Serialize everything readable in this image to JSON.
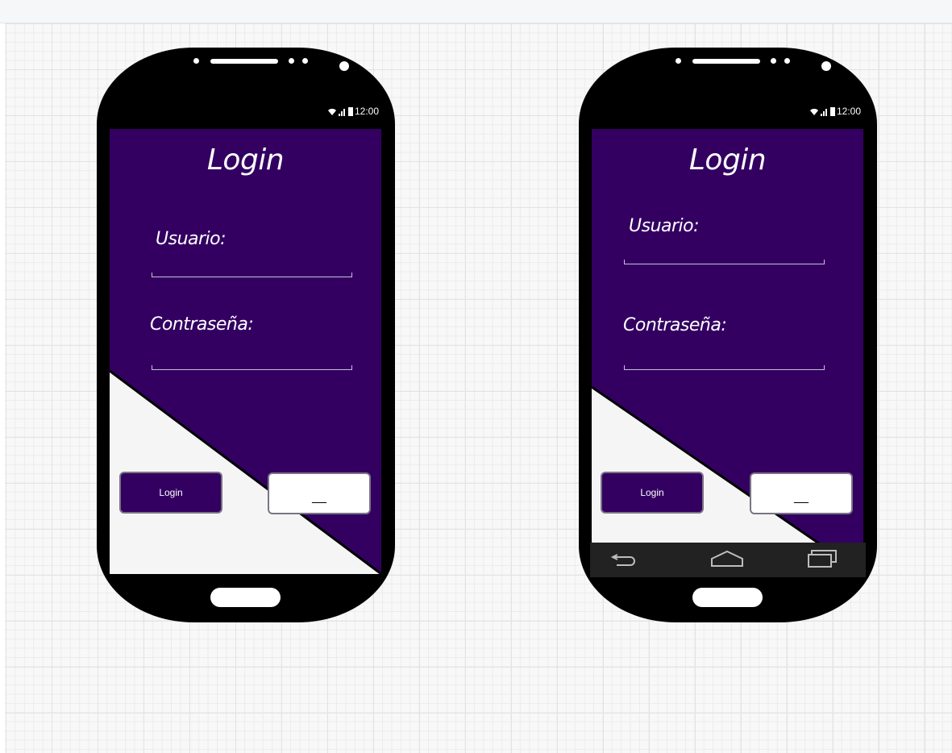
{
  "phones": [
    {
      "status_time": "12:00",
      "title": "Login",
      "user_label": "Usuario:",
      "password_label": "Contraseña:",
      "login_button": "Login",
      "second_button": "__",
      "has_nav_bar": false
    },
    {
      "status_time": "12:00",
      "title": "Login",
      "user_label": "Usuario:",
      "password_label": "Contraseña:",
      "login_button": "Login",
      "second_button": "__",
      "has_nav_bar": true,
      "nav_icons": [
        "back-icon",
        "home-icon",
        "recents-icon"
      ]
    }
  ],
  "colors": {
    "primary": "#330062",
    "screen_light": "#f5f5f5",
    "phone_body": "#000000"
  }
}
